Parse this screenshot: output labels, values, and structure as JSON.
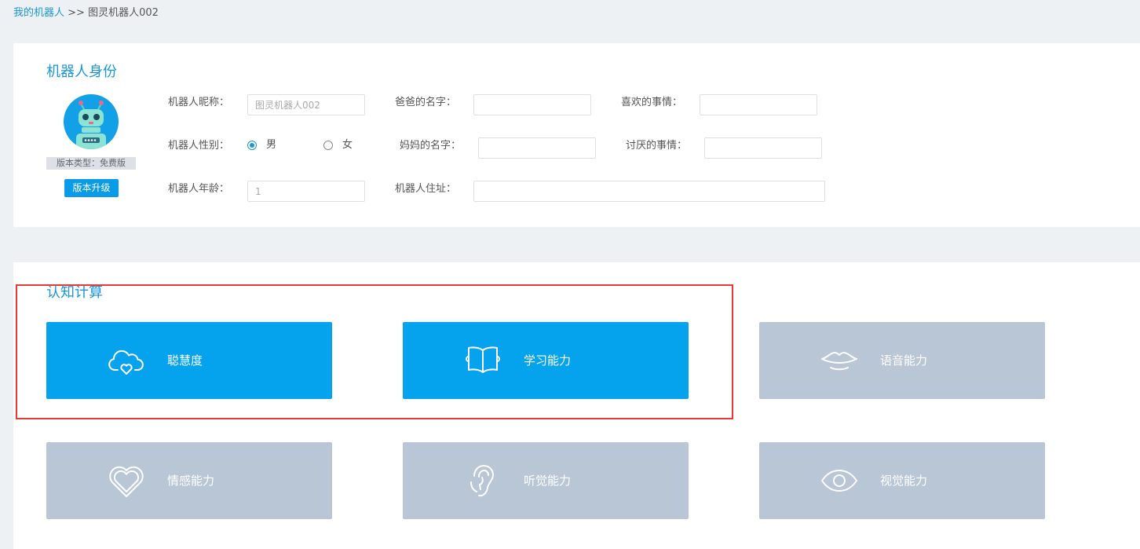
{
  "breadcrumb": {
    "link": "我的机器人",
    "separator": " >> ",
    "current": "图灵机器人002"
  },
  "identity": {
    "title": "机器人身份",
    "version_type": "版本类型：免费版",
    "upgrade_button": "版本升级",
    "fields": {
      "nickname": {
        "label": "机器人昵称：",
        "value": "",
        "placeholder": "图灵机器人002"
      },
      "father": {
        "label": "爸爸的名字：",
        "value": ""
      },
      "likes": {
        "label": "喜欢的事情：",
        "value": ""
      },
      "gender": {
        "label": "机器人性别：",
        "options": [
          "男",
          "女"
        ],
        "selected": "男"
      },
      "mother": {
        "label": "妈妈的名字：",
        "value": ""
      },
      "dislikes": {
        "label": "讨厌的事情：",
        "value": ""
      },
      "age": {
        "label": "机器人年龄：",
        "value": "",
        "placeholder": "1"
      },
      "address": {
        "label": "机器人住址：",
        "value": ""
      }
    }
  },
  "cognition": {
    "title": "认知计算",
    "tiles": [
      {
        "label": "聪慧度",
        "icon": "cloud-heart-icon",
        "state": "active"
      },
      {
        "label": "学习能力",
        "icon": "book-icon",
        "state": "active"
      },
      {
        "label": "语音能力",
        "icon": "lips-icon",
        "state": "inactive"
      },
      {
        "label": "情感能力",
        "icon": "heart-icon",
        "state": "inactive"
      },
      {
        "label": "听觉能力",
        "icon": "ear-icon",
        "state": "inactive"
      },
      {
        "label": "视觉能力",
        "icon": "eye-icon",
        "state": "inactive"
      }
    ]
  },
  "colors": {
    "accent": "#1a96d8",
    "tile_active": "#05a3ee",
    "tile_inactive": "#b9c6d6",
    "highlight_frame": "#e5393b"
  }
}
